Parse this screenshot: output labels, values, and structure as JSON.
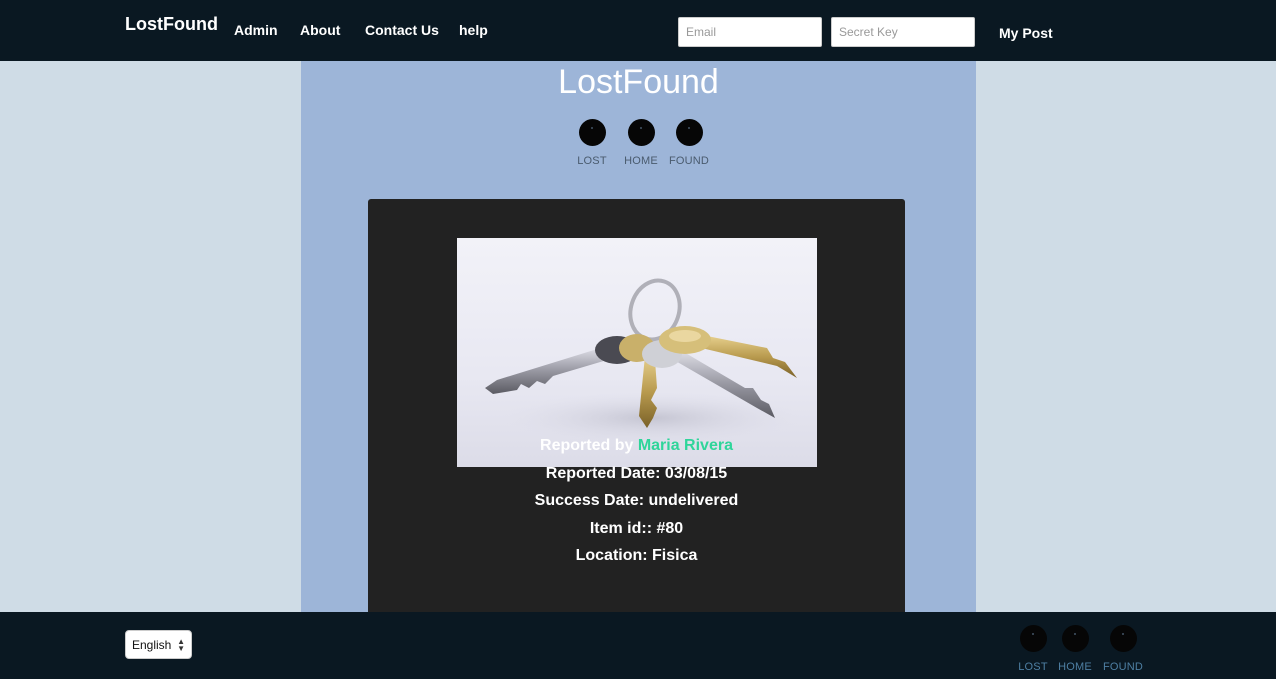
{
  "navbar": {
    "brand": "LostFound",
    "links": [
      "Admin",
      "About",
      "Contact Us",
      "help"
    ],
    "email_placeholder": "Email",
    "secret_placeholder": "Secret Key",
    "my_post": "My Post"
  },
  "main": {
    "title": "LostFound",
    "circle_nav": [
      "LOST",
      "HOME",
      "FOUND"
    ]
  },
  "item": {
    "image_desc": "keys-photo",
    "reported_by_label": "Reported by",
    "reported_by_name": "Maria Rivera",
    "reported_date": "Reported Date: 03/08/15",
    "success_date": "Success Date: undelivered",
    "item_id": "Item id:: #80",
    "location": "Location: Fisica"
  },
  "footer": {
    "language": "English",
    "circle_nav": [
      "LOST",
      "HOME",
      "FOUND"
    ]
  },
  "colors": {
    "navbar_bg": "#0a1822",
    "main_bg": "#9db5d8",
    "page_bg": "#cfdce6",
    "card_bg": "#222222",
    "accent": "#2fd59a"
  }
}
